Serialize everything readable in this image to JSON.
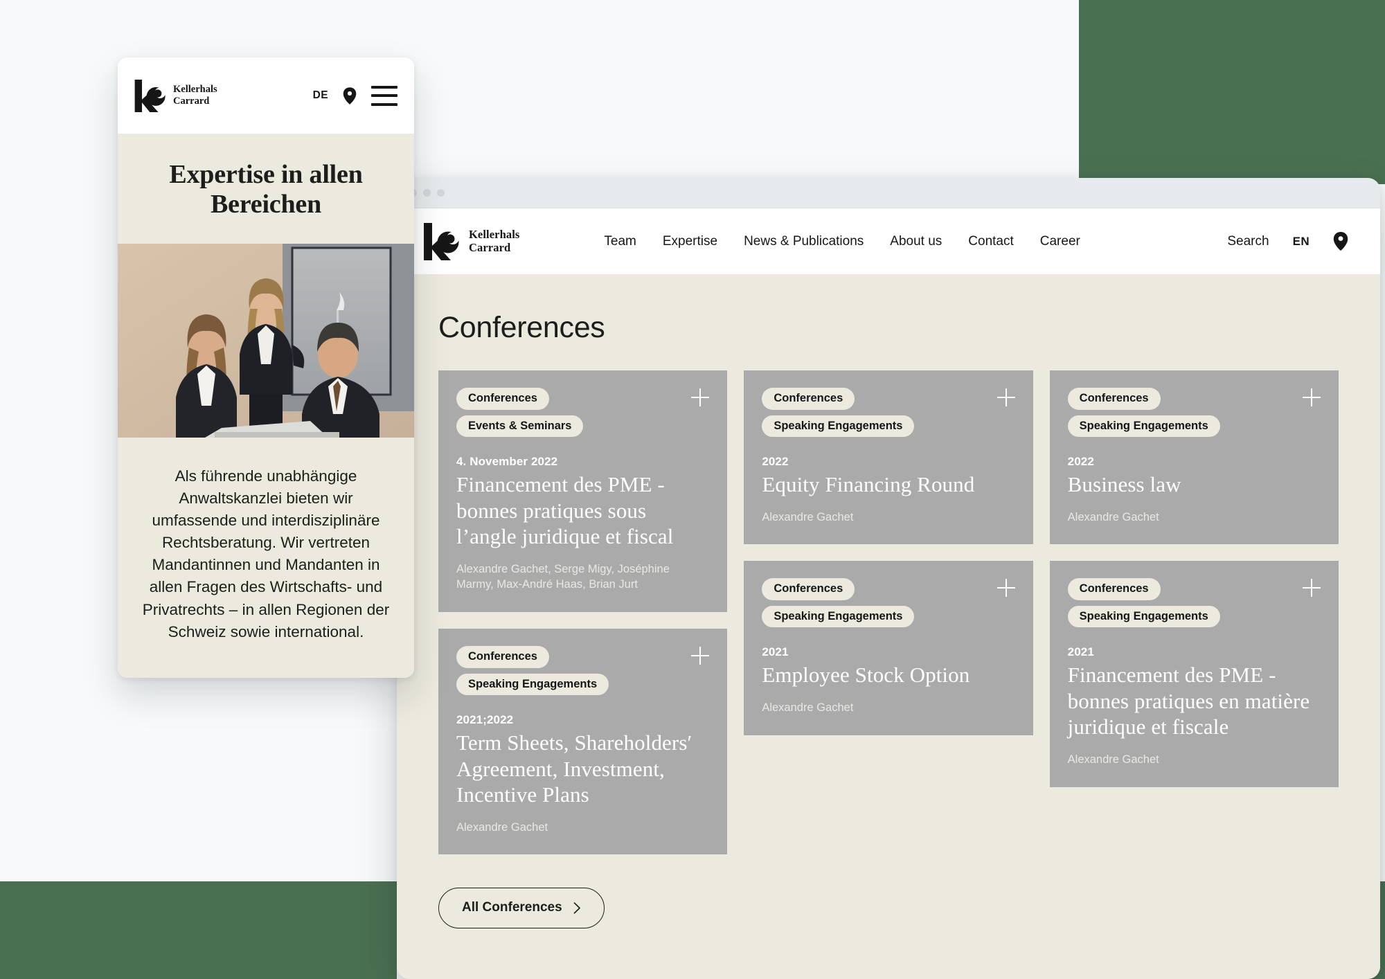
{
  "colors": {
    "page_cream": "#eceade",
    "card_gray": "#aaaaaa",
    "backdrop_green": "#4a7052",
    "backdrop_light": "#f7f9fa",
    "ink": "#1d1d1b",
    "white": "#ffffff"
  },
  "mobile": {
    "brand_name": "Kellerhals\nCarrard",
    "lang": "DE",
    "pin_icon": "location-pin-icon",
    "menu_icon": "hamburger-menu-icon",
    "hero_title": "Expertise in allen Bereichen",
    "photo_alt": "three-lawyers-at-laptop-photo",
    "body_text": "Als führende unabhängige Anwaltskanzlei bieten wir umfassende und interdisziplinäre Rechtsberatung. Wir vertreten Mandantinnen und Mandanten in allen Fragen des Wirtschafts- und Privatrechts – in allen Regionen der Schweiz sowie international."
  },
  "desktop": {
    "chrome": {
      "dots": 3
    },
    "brand_name": "Kellerhals\nCarrard",
    "nav_links": [
      {
        "label": "Team"
      },
      {
        "label": "Expertise"
      },
      {
        "label": "News & Publications"
      },
      {
        "label": "About us"
      },
      {
        "label": "Contact"
      },
      {
        "label": "Career"
      }
    ],
    "nav_right": {
      "search_label": "Search",
      "lang": "EN",
      "pin_icon": "location-pin-icon"
    },
    "page_title": "Conferences",
    "cta": {
      "label": "All Conferences",
      "icon": "chevron-right-icon"
    },
    "columns": [
      {
        "cards": [
          {
            "tags": [
              "Conferences",
              "Events & Seminars"
            ],
            "date": "4. November 2022",
            "title": "Financement des PME - bonnes pratiques sous l’angle juridique et fiscal",
            "authors": "Alexandre Gachet, Serge Migy, Joséphine Marmy, Max-André Haas, Brian Jurt",
            "expand_icon": "plus-icon"
          },
          {
            "tags": [
              "Conferences",
              "Speaking Engagements"
            ],
            "date": "2021;2022",
            "title": "Term Sheets, Shareholders′ Agreement, Investment, Incentive Plans",
            "authors": "Alexandre Gachet",
            "expand_icon": "plus-icon"
          }
        ]
      },
      {
        "cards": [
          {
            "tags": [
              "Conferences",
              "Speaking Engagements"
            ],
            "date": "2022",
            "title": "Equity Financing Round",
            "authors": "Alexandre Gachet",
            "expand_icon": "plus-icon"
          },
          {
            "tags": [
              "Conferences",
              "Speaking Engagements"
            ],
            "date": "2021",
            "title": "Employee Stock Option",
            "authors": "Alexandre Gachet",
            "expand_icon": "plus-icon"
          }
        ]
      },
      {
        "cards": [
          {
            "tags": [
              "Conferences",
              "Speaking Engagements"
            ],
            "date": "2022",
            "title": "Business law",
            "authors": "Alexandre Gachet",
            "expand_icon": "plus-icon"
          },
          {
            "tags": [
              "Conferences",
              "Speaking Engagements"
            ],
            "date": "2021",
            "title": "Financement des PME - bonnes pratiques en matière juridique et fiscale",
            "authors": "Alexandre Gachet",
            "expand_icon": "plus-icon"
          }
        ]
      }
    ]
  }
}
